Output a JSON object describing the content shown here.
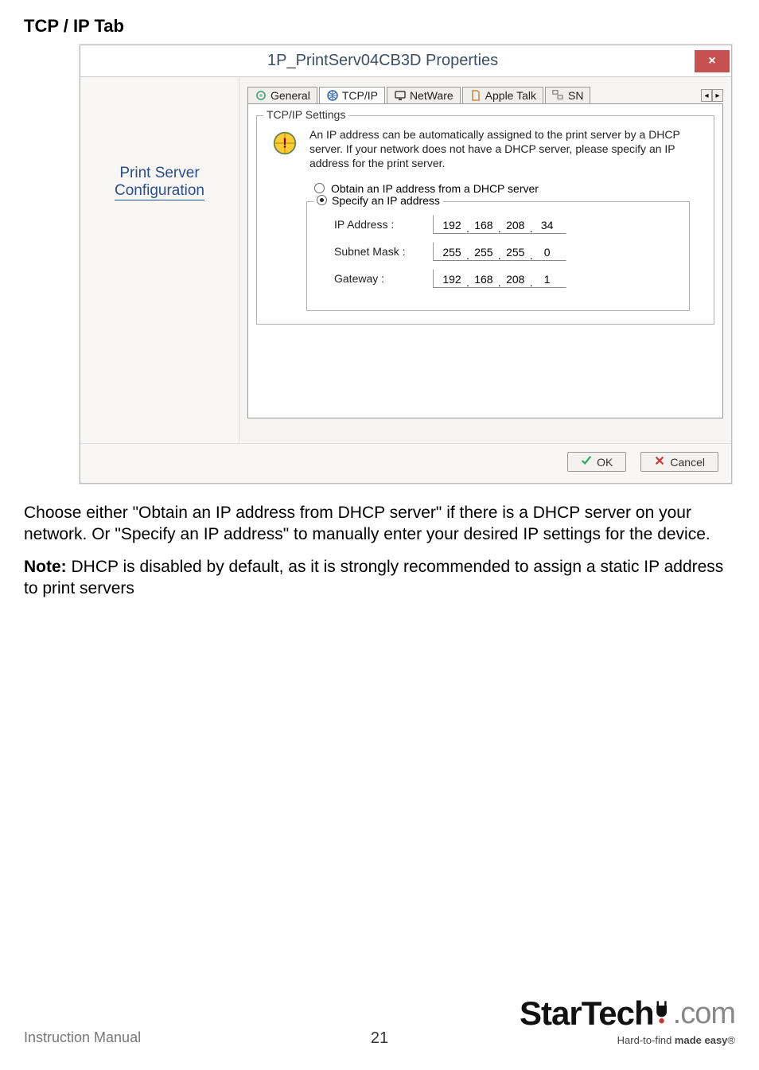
{
  "heading": "TCP / IP Tab",
  "dialog": {
    "title": "1P_PrintServ04CB3D Properties",
    "close_glyph": "×",
    "sidebar": {
      "line1": "Print Server",
      "line2": "Configuration"
    },
    "tabs": {
      "general": "General",
      "tcpip": "TCP/IP",
      "netware": "NetWare",
      "appletalk": "Apple Talk",
      "snmp_partial": "SN"
    },
    "group": {
      "title": "TCP/IP Settings",
      "info_text": "An IP address can be automatically assigned to the print server by a DHCP server. If your network does not have a DHCP server, please specify an IP address for the print server.",
      "radio_dhcp": "Obtain an IP address from a DHCP server",
      "radio_manual": "Specify an IP address",
      "fields": {
        "ip_label": "IP Address :",
        "ip": [
          "192",
          "168",
          "208",
          "34"
        ],
        "mask_label": "Subnet Mask :",
        "mask": [
          "255",
          "255",
          "255",
          "0"
        ],
        "gw_label": "Gateway :",
        "gw": [
          "192",
          "168",
          "208",
          "1"
        ]
      }
    },
    "buttons": {
      "ok": "OK",
      "cancel": "Cancel"
    }
  },
  "body1": "Choose either \"Obtain an IP address from DHCP server\" if there is a DHCP server on your network. Or \"Specify an IP address\" to manually enter your desired IP settings for the device.",
  "body2_bold": "Note:",
  "body2_rest": " DHCP is disabled by default, as it is strongly recommended to assign a static IP address to print servers",
  "footer": {
    "left": "Instruction Manual",
    "page": "21",
    "logo_main": "StarTech",
    "logo_suffix": ".com",
    "tagline_pre": "Hard-to-find ",
    "tagline_bold": "made easy",
    "tagline_reg": "®"
  }
}
